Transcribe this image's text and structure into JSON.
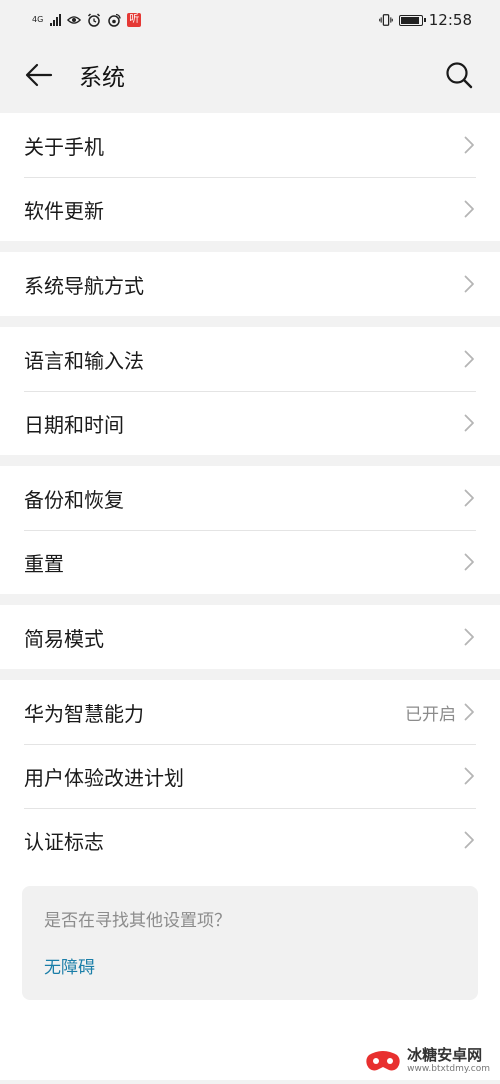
{
  "status": {
    "network": "4G",
    "time": "12:58",
    "app_badge": "听",
    "battery_level": 0.9
  },
  "header": {
    "title": "系统"
  },
  "groups": [
    {
      "items": [
        {
          "label": "关于手机"
        },
        {
          "label": "软件更新"
        }
      ]
    },
    {
      "items": [
        {
          "label": "系统导航方式"
        }
      ]
    },
    {
      "items": [
        {
          "label": "语言和输入法"
        },
        {
          "label": "日期和时间"
        }
      ]
    },
    {
      "items": [
        {
          "label": "备份和恢复"
        },
        {
          "label": "重置"
        }
      ]
    },
    {
      "items": [
        {
          "label": "简易模式"
        }
      ]
    },
    {
      "items": [
        {
          "label": "华为智慧能力",
          "value": "已开启"
        },
        {
          "label": "用户体验改进计划"
        },
        {
          "label": "认证标志"
        }
      ]
    }
  ],
  "hint": {
    "question": "是否在寻找其他设置项？",
    "link": "无障碍"
  },
  "watermark": {
    "name": "冰糖安卓网",
    "url": "www.btxtdmy.com"
  },
  "colors": {
    "link": "#1b7ea8",
    "background": "#f2f2f2"
  }
}
